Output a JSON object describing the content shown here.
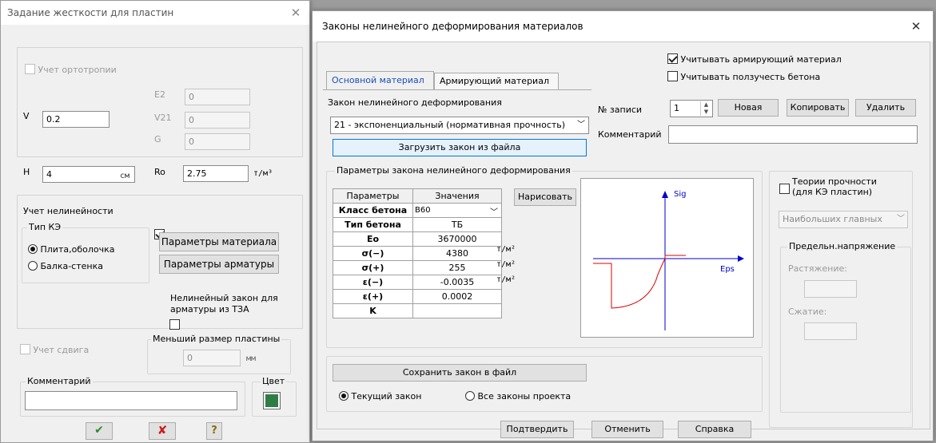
{
  "left_dialog": {
    "title": "Задание жесткости для пластин",
    "orthotropy_label": "Учет ортотропии",
    "e2_label": "E2",
    "e2_value": "0",
    "v_label": "V",
    "v_value": "0.2",
    "v21_label": "V21",
    "v21_value": "0",
    "g_label": "G",
    "g_value": "0",
    "h_label": "H",
    "h_value": "4",
    "h_unit": "см",
    "ro_label": "Ro",
    "ro_value": "2.75",
    "ro_unit": "т/м³",
    "nonlinearity_label": "Учет нелинейности",
    "fe_type_label": "Тип КЭ",
    "radio_plate": "Плита,оболочка",
    "radio_beam_wall": "Балка-стенка",
    "material_params_button": "Параметры материала",
    "rebar_params_button": "Параметры арматуры",
    "nonlinear_rebar_label_1": "Нелинейный закон для",
    "nonlinear_rebar_label_2": "арматуры из ТЗА",
    "shear_label": "Учет сдвига",
    "min_size_label": "Меньший размер пластины",
    "min_size_value": "0",
    "min_size_unit": "мм",
    "comment_label": "Комментарий",
    "comment_value": "",
    "color_label": "Цвет",
    "color_swatch": "#2f7d45"
  },
  "right_dialog": {
    "title": "Законы нелинейного деформирования материалов",
    "consider_rebar_label": "Учитывать армирующий материал",
    "consider_creep_label": "Учитывать ползучесть бетона",
    "tabs": [
      "Основной материал",
      "Армирующий материал"
    ],
    "law_label": "Закон нелинейного деформирования",
    "law_value": "21 - экспоненциальный (нормативная прочность)",
    "load_law_button": "Загрузить закон из файла",
    "record_no_label": "№ записи",
    "record_no_value": "1",
    "new_button": "Новая",
    "copy_button": "Копировать",
    "delete_button": "Удалить",
    "comment_label": "Комментарий",
    "comment_value": "",
    "params_group_label": "Параметры закона нелинейного деформирования",
    "table_headers": [
      "Параметры",
      "Значения"
    ],
    "class_label": "Класс бетона",
    "class_value": "B60",
    "rows": [
      {
        "param": "Тип бетона",
        "value": "ТБ",
        "unit": ""
      },
      {
        "param": "Eo",
        "value": "3670000",
        "unit": "т/м²"
      },
      {
        "param": "σ(−)",
        "value": "4380",
        "unit": "т/м²"
      },
      {
        "param": "σ(+)",
        "value": "255",
        "unit": "т/м²"
      },
      {
        "param": "ε(−)",
        "value": "-0.0035",
        "unit": ""
      },
      {
        "param": "ε(+)",
        "value": "0.0002",
        "unit": ""
      },
      {
        "param": "K",
        "value": "",
        "unit": ""
      }
    ],
    "draw_button": "Нарисовать",
    "plot_y_label": "Sig",
    "plot_x_label": "Eps",
    "strength_theories_label_1": "Теории прочности",
    "strength_theories_label_2": "(для КЭ пластин)",
    "theory_value": "Наибольших главных",
    "limit_stress_label": "Предельн.напряжение",
    "tension_label": "Растяжение:",
    "compression_label": "Сжатие:",
    "save_law_button": "Сохранить закон в файл",
    "radio_current": "Текущий закон",
    "radio_all": "Все законы проекта",
    "confirm_button": "Подтвердить",
    "cancel_button": "Отменить",
    "help_button": "Справка"
  }
}
